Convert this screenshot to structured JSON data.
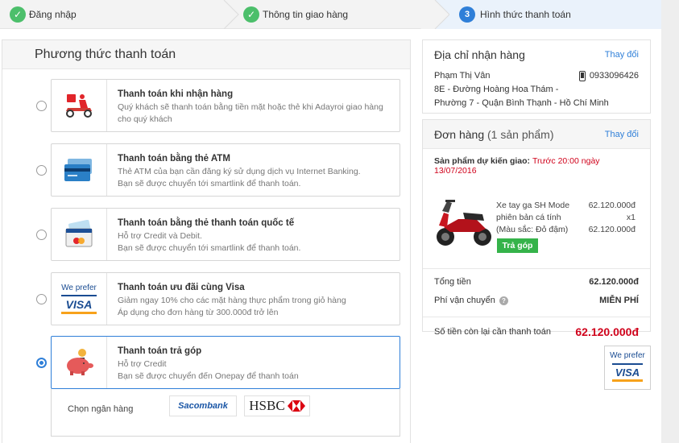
{
  "steps": [
    {
      "label": "Đăng nhập",
      "state": "done"
    },
    {
      "label": "Thông tin giao hàng",
      "state": "done"
    },
    {
      "label": "Hình thức thanh toán",
      "state": "active",
      "number": "3"
    }
  ],
  "payment": {
    "title": "Phương thức thanh toán",
    "options": [
      {
        "title": "Thanh toán khi nhận hàng",
        "lines": [
          "Quý khách sẽ thanh toán bằng tiền mặt hoặc thẻ khi Adayroi giao hàng",
          "cho quý khách"
        ],
        "icon": "delivery-scooter-icon",
        "selected": false
      },
      {
        "title": "Thanh toán bằng thẻ ATM",
        "lines": [
          "Thẻ ATM của bạn cần đăng ký sử dụng dịch vụ Internet Banking.",
          "Bạn sẽ được chuyển tới smartlink để thanh toán."
        ],
        "icon": "atm-card-icon",
        "selected": false
      },
      {
        "title": "Thanh toán bằng thẻ thanh toán quốc tế",
        "lines": [
          "Hỗ trợ Credit và Debit.",
          "Bạn sẽ được chuyển tới smartlink để thanh toán."
        ],
        "icon": "international-card-icon",
        "selected": false
      },
      {
        "title": "Thanh toán ưu đãi cùng Visa",
        "lines": [
          "Giảm ngay 10% cho các mặt hàng thực phẩm trong giỏ hàng",
          "Áp dụng cho đơn hàng từ 300.000đ trở lên"
        ],
        "icon": "we-prefer-visa-icon",
        "icon_text": {
          "top": "We prefer",
          "brand": "VISA"
        },
        "selected": false
      },
      {
        "title": "Thanh toán trả góp",
        "lines": [
          "Hỗ trợ Credit",
          "Bạn sẽ được chuyển đến Onepay để thanh toán"
        ],
        "icon": "piggy-bank-icon",
        "selected": true
      }
    ],
    "bank_label": "Chọn ngân hàng",
    "banks": [
      "Sacombank",
      "HSBC"
    ]
  },
  "address": {
    "title": "Địa chỉ nhận hàng",
    "change": "Thay đổi",
    "name": "Phạm Thị Vân",
    "phone": "0933096426",
    "line1": "8E - Đường Hoàng Hoa Thám -",
    "line2": "Phường 7 - Quận Bình Thạnh - Hồ Chí Minh"
  },
  "order": {
    "title": "Đơn hàng",
    "count": "(1 sản phẩm)",
    "change": "Thay đổi",
    "expected_label": "Sản phẩm dự kiến giao:",
    "expected_date": "Trước 20:00 ngày 13/07/2016",
    "product": {
      "name_lines": [
        "Xe tay ga SH Mode",
        "phiên bản cá tính",
        "(Màu sắc: Đỏ đậm)"
      ],
      "price_lines": [
        "62.120.000đ",
        "x1",
        "62.120.000đ"
      ],
      "badge": "Trả góp"
    },
    "total_label": "Tổng tiền",
    "total_value": "62.120.000đ",
    "shipping_label": "Phí vận chuyển",
    "shipping_value": "MIỄN PHÍ",
    "remaining_label": "Số tiền còn lại cần thanh toán",
    "remaining_value": "62.120.000đ"
  },
  "visa_badge": {
    "top": "We prefer",
    "brand": "VISA"
  },
  "colors": {
    "accent": "#2f7fd8",
    "success": "#4cbf6b",
    "price": "#d0021b",
    "badge": "#35b34a"
  }
}
